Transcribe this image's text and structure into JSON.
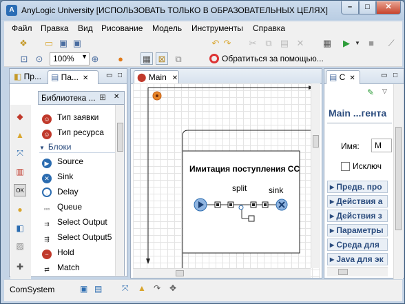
{
  "window": {
    "title": "AnyLogic University [ИСПОЛЬЗОВАТЬ ТОЛЬКО В ОБРАЗОВАТЕЛЬНЫХ ЦЕЛЯХ]",
    "app_icon_letter": "A",
    "min_glyph": "–",
    "max_glyph": "□",
    "close_glyph": "✕"
  },
  "menu": {
    "items": [
      "Файл",
      "Правка",
      "Вид",
      "Рисование",
      "Модель",
      "Инструменты",
      "Справка"
    ]
  },
  "toolbar": {
    "zoom_value": "100%",
    "help_label": "Обратиться за помощью..."
  },
  "left_panel": {
    "tab1": "Пр...",
    "tab2": "Па...",
    "close_glyph": "✕",
    "palette_title": "Библиотека ...",
    "items_top": [
      {
        "label": "Тип заявки"
      },
      {
        "label": "Тип ресурса"
      }
    ],
    "section_label": "Блоки",
    "blocks": [
      {
        "label": "Source"
      },
      {
        "label": "Sink"
      },
      {
        "label": "Delay"
      },
      {
        "label": "Queue"
      },
      {
        "label": "Select Output"
      },
      {
        "label": "Select Output5"
      },
      {
        "label": "Hold"
      },
      {
        "label": "Match"
      }
    ]
  },
  "editor": {
    "tab_label": "Main",
    "close_glyph": "✕",
    "group_title": "Имитация поступления СС",
    "split_label": "split",
    "sink_label": "sink"
  },
  "properties": {
    "tab_label": "С",
    "close_glyph": "✕",
    "title": "Main ...гента",
    "name_label": "Имя:",
    "name_value": "M",
    "checkbox_label": "Исключ",
    "sections": [
      "Предв. про",
      "Действия а",
      "Действия з",
      "Параметры",
      "Среда для",
      "Java для эк"
    ]
  },
  "status": {
    "text": "ComSystem"
  },
  "colors": {
    "accent": "#2b4c7e",
    "selection": "#f0a04b",
    "close_button": "#c7432c"
  }
}
